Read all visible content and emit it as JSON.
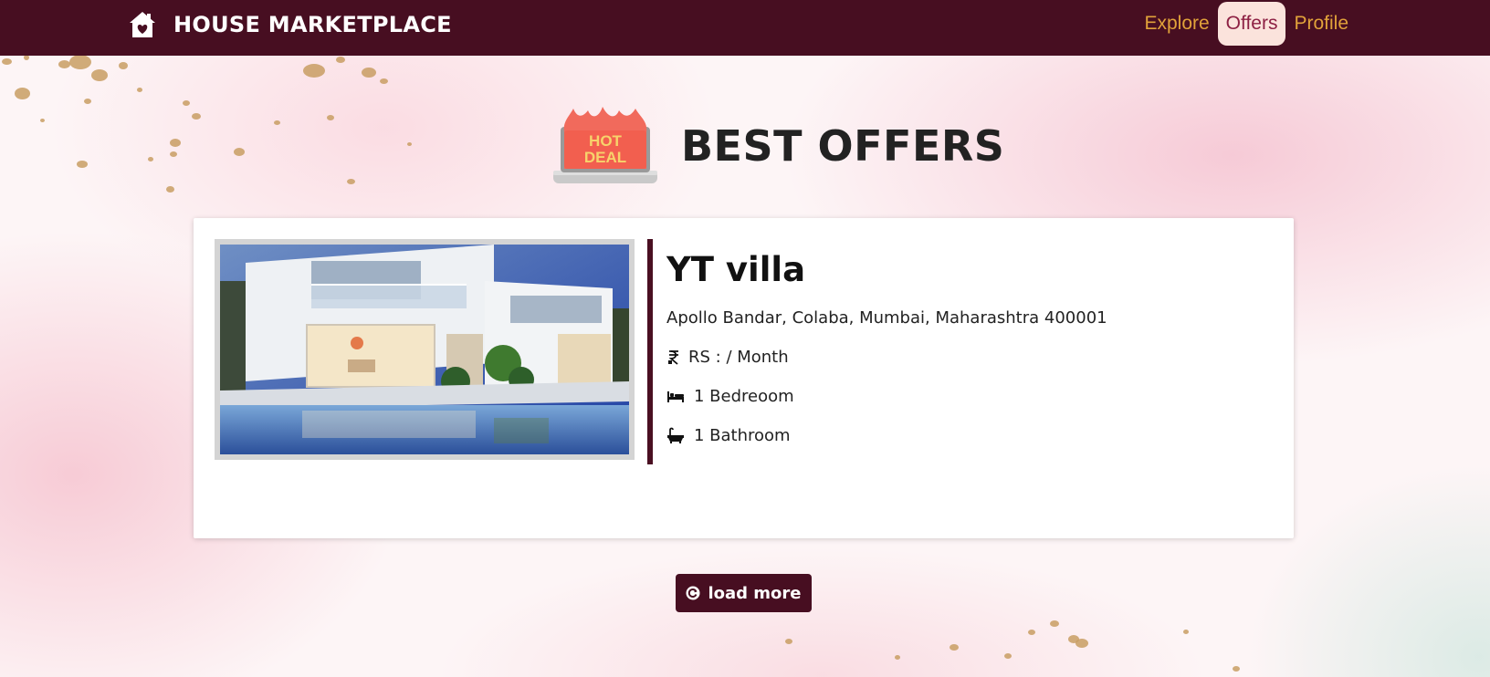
{
  "navbar": {
    "brand": "HOUSE MARKETPLACE",
    "links": [
      {
        "label": "Explore",
        "active": false
      },
      {
        "label": "Offers",
        "active": true
      },
      {
        "label": "Profile",
        "active": false
      }
    ]
  },
  "page": {
    "heading": "BEST OFFERS",
    "badge": {
      "line1": "HOT",
      "line2": "DEAL"
    }
  },
  "listing": {
    "title": "YT villa",
    "address": "Apollo Bandar, Colaba, Mumbai, Maharashtra 400001",
    "price": "RS : / Month",
    "bedrooms": "1 Bedreoom",
    "bathrooms": "1 Bathroom"
  },
  "actions": {
    "load_more": "load more"
  },
  "colors": {
    "primary": "#470e21",
    "nav_link": "#e1a23a",
    "nav_active_bg": "#fbe3dc",
    "nav_active_text": "#8d2043"
  },
  "icons": {
    "brand": "house-icon",
    "price": "rupee-icon",
    "bedroom": "bed-icon",
    "bathroom": "bathtub-icon",
    "load_more": "refresh-icon"
  }
}
